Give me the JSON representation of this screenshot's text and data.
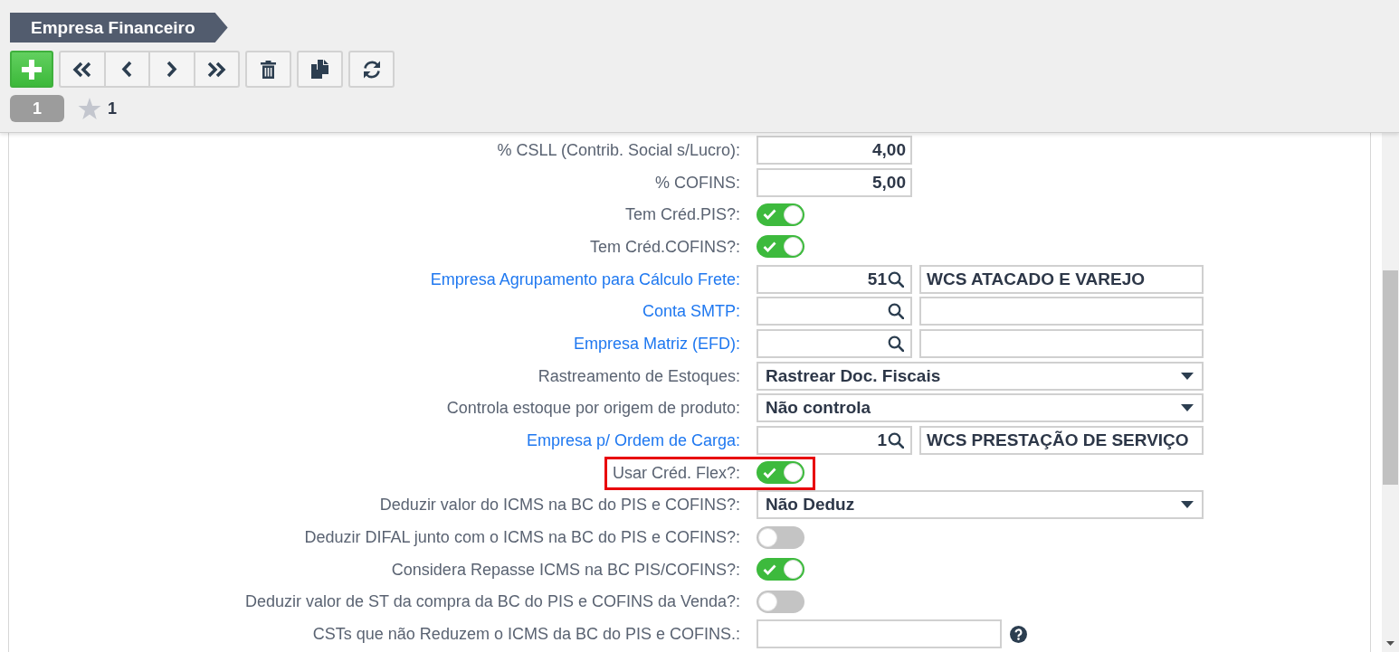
{
  "header": {
    "title": "Empresa Financeiro"
  },
  "record_bar": {
    "record_number": "1",
    "star_count": "1"
  },
  "form": {
    "rows": [
      {
        "label": "% CSLL (Contrib. Social s/Lucro):",
        "link": false,
        "highlighted": false,
        "kind": "number",
        "value": "4,00"
      },
      {
        "label": "% COFINS:",
        "link": false,
        "highlighted": false,
        "kind": "number",
        "value": "5,00"
      },
      {
        "label": "Tem Créd.PIS?:",
        "link": false,
        "highlighted": false,
        "kind": "toggle",
        "on": true
      },
      {
        "label": "Tem Créd.COFINS?:",
        "link": false,
        "highlighted": false,
        "kind": "toggle",
        "on": true
      },
      {
        "label": "Empresa Agrupamento para Cálculo Frete:",
        "link": true,
        "highlighted": false,
        "kind": "lookup",
        "code": "51",
        "description": "WCS ATACADO E VAREJO"
      },
      {
        "label": "Conta SMTP:",
        "link": true,
        "highlighted": false,
        "kind": "lookup"
      },
      {
        "label": "Empresa Matriz (EFD):",
        "link": true,
        "highlighted": false,
        "kind": "lookup"
      },
      {
        "label": "Rastreamento de Estoques:",
        "link": false,
        "highlighted": false,
        "kind": "select",
        "value": "Rastrear Doc. Fiscais"
      },
      {
        "label": "Controla estoque por origem de produto:",
        "link": false,
        "highlighted": false,
        "kind": "select",
        "value": "Não controla"
      },
      {
        "label": "Empresa p/ Ordem de Carga:",
        "link": true,
        "highlighted": false,
        "kind": "lookup",
        "code": "1",
        "description": "WCS PRESTAÇÃO DE SERVIÇO"
      },
      {
        "label": "Usar Créd. Flex?:",
        "link": false,
        "highlighted": true,
        "kind": "toggle",
        "on": true
      },
      {
        "label": "Deduzir valor do ICMS na BC do PIS e COFINS?:",
        "link": false,
        "highlighted": false,
        "kind": "select",
        "value": "Não Deduz"
      },
      {
        "label": "Deduzir DIFAL junto com o ICMS na BC do PIS e COFINS?:",
        "link": false,
        "highlighted": false,
        "kind": "toggle",
        "on": false
      },
      {
        "label": "Considera Repasse ICMS na BC PIS/COFINS?:",
        "link": false,
        "highlighted": false,
        "kind": "toggle",
        "on": true
      },
      {
        "label": "Deduzir valor de ST da compra da BC do PIS e COFINS da Venda?:",
        "link": false,
        "highlighted": false,
        "kind": "toggle",
        "on": false
      },
      {
        "label": "CSTs que não Reduzem o ICMS da BC do PIS e COFINS.:",
        "link": false,
        "highlighted": false,
        "kind": "text_help"
      }
    ]
  }
}
